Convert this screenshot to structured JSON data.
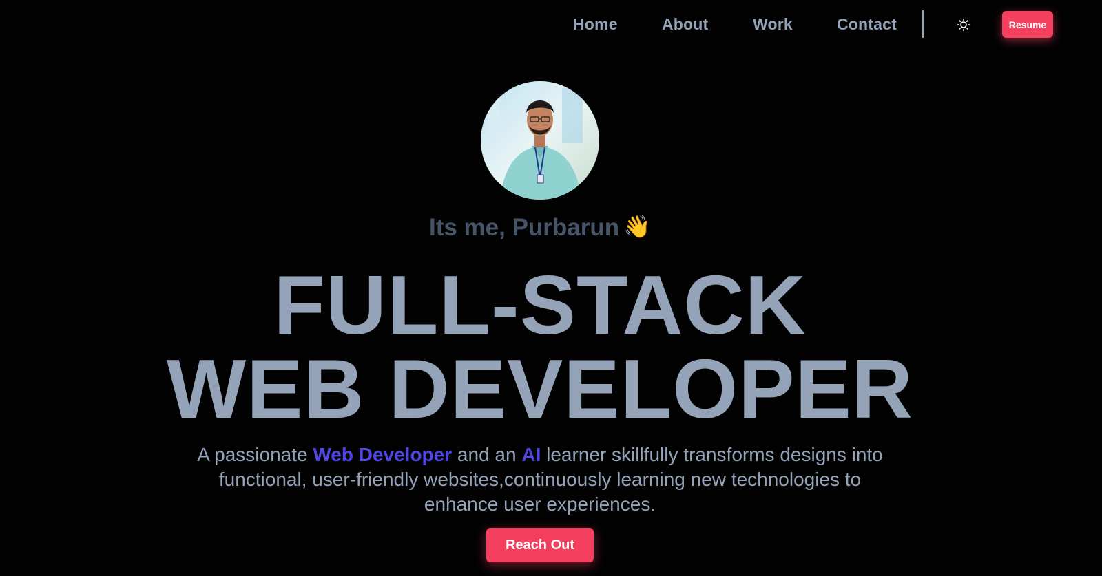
{
  "nav": {
    "links": [
      {
        "label": "Home"
      },
      {
        "label": "About"
      },
      {
        "label": "Work"
      },
      {
        "label": "Contact"
      }
    ],
    "theme_icon": "sun-icon",
    "resume_label": "Resume"
  },
  "hero": {
    "avatar_icon": "profile-photo",
    "greeting": "Its me, Purbarun",
    "greeting_emoji": "👋",
    "headline_line1": "FULL-STACK",
    "headline_line2": "WEB DEVELOPER",
    "bio": {
      "part1": "A passionate ",
      "highlight1": "Web Developer",
      "part2": " and an ",
      "highlight2": "AI",
      "part3": " learner skillfully transforms designs into functional, user-friendly websites,continuously learning new technologies to enhance user experiences."
    },
    "cta_label": "Reach Out"
  },
  "colors": {
    "background": "#020203",
    "text": "#94a3b8",
    "greeting": "#475569",
    "accent": "#4f46e5",
    "button": "#f43f5e"
  }
}
